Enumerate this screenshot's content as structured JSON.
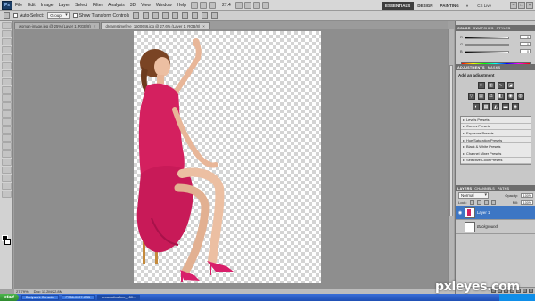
{
  "app": {
    "logo": "Ps"
  },
  "menu": [
    "File",
    "Edit",
    "Image",
    "Layer",
    "Select",
    "Filter",
    "Analysis",
    "3D",
    "View",
    "Window",
    "Help"
  ],
  "zoom_readout": "27.4",
  "workspace": {
    "buttons": [
      "ESSENTIALS",
      "DESIGN",
      "PAINTING"
    ],
    "more": "»",
    "cs_live": "CS Live"
  },
  "window_controls": [
    "–",
    "□",
    "×"
  ],
  "options": {
    "auto_select_label": "Auto-Select:",
    "auto_select_value": "Group",
    "transform_label": "Show Transform Controls"
  },
  "doc_tabs": [
    {
      "label": "woman-image.jpg @ 25% (Layer 1, RGB/8)",
      "active": false
    },
    {
      "label": "dreamstimefree_1500646.jpg @ 27.6% (Layer 1, RGB/8)",
      "active": true
    }
  ],
  "status": {
    "zoom": "27.79%",
    "doc": "Doc: 11.2M/22.8M"
  },
  "color_panel": {
    "tabs": [
      "COLOR",
      "SWATCHES",
      "STYLES"
    ],
    "sliders": [
      {
        "label": "R",
        "value": "0"
      },
      {
        "label": "G",
        "value": "0"
      },
      {
        "label": "B",
        "value": "0"
      }
    ]
  },
  "adjustments": {
    "tabs": [
      "ADJUSTMENTS",
      "MASKS"
    ],
    "title": "Add an adjustment",
    "presets": [
      "Levels Presets",
      "Curves Presets",
      "Exposure Presets",
      "Hue/Saturation Presets",
      "Black & White Presets",
      "Channel Mixer Presets",
      "Selective Color Presets"
    ]
  },
  "layers": {
    "tabs": [
      "LAYERS",
      "CHANNELS",
      "PATHS"
    ],
    "blend_mode": "Normal",
    "opacity_label": "Opacity:",
    "opacity_value": "100%",
    "lock_label": "Lock:",
    "fill_label": "Fill:",
    "fill_value": "100%",
    "items": [
      {
        "name": "Layer 1",
        "selected": true
      },
      {
        "name": "Background",
        "selected": false
      }
    ]
  },
  "taskbar": {
    "start": "start",
    "items": [
      {
        "label": "Bodywork Console",
        "active": false
      },
      {
        "label": "PS56-0007-CS5",
        "active": false
      },
      {
        "label": "dreamstimefree_150...",
        "active": true
      }
    ]
  },
  "watermark": "pxleyes.com",
  "colors": {
    "dress": "#d4205f",
    "selection": "#3d76c4",
    "taskbar": "#2a5fcc"
  }
}
